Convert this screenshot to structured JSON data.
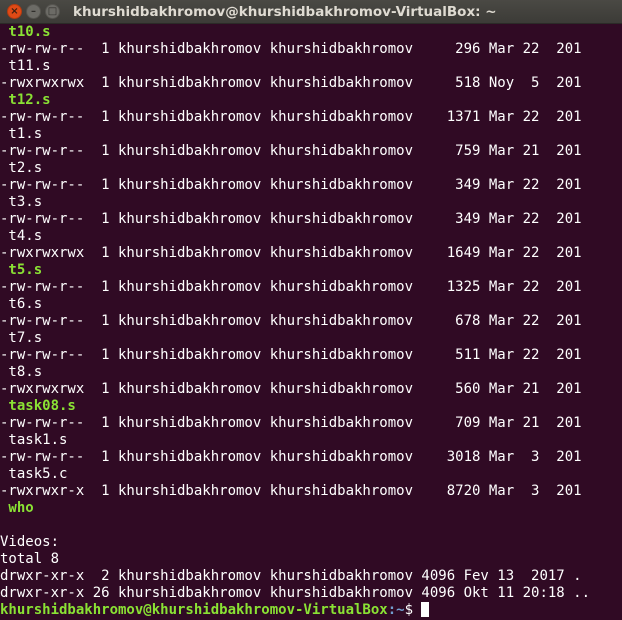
{
  "window": {
    "title": "khurshidbakhromov@khurshidbakhromov-VirtualBox: ~",
    "close_symbol": "×",
    "minimize_symbol": "–",
    "maximize_symbol": "□"
  },
  "terminal": {
    "lines": [
      {
        "text": " t10.s",
        "style": "green"
      },
      {
        "text": "-rw-rw-r--  1 khurshidbakhromov khurshidbakhromov     296 Mar 22  201",
        "style": "plain"
      },
      {
        "text": " t11.s",
        "style": "plain"
      },
      {
        "text": "-rwxrwxrwx  1 khurshidbakhromov khurshidbakhromov     518 Noy  5  201",
        "style": "plain"
      },
      {
        "text": " t12.s",
        "style": "green"
      },
      {
        "text": "-rw-rw-r--  1 khurshidbakhromov khurshidbakhromov    1371 Mar 22  201",
        "style": "plain"
      },
      {
        "text": " t1.s",
        "style": "plain"
      },
      {
        "text": "-rw-rw-r--  1 khurshidbakhromov khurshidbakhromov     759 Mar 21  201",
        "style": "plain"
      },
      {
        "text": " t2.s",
        "style": "plain"
      },
      {
        "text": "-rw-rw-r--  1 khurshidbakhromov khurshidbakhromov     349 Mar 22  201",
        "style": "plain"
      },
      {
        "text": " t3.s",
        "style": "plain"
      },
      {
        "text": "-rw-rw-r--  1 khurshidbakhromov khurshidbakhromov     349 Mar 22  201",
        "style": "plain"
      },
      {
        "text": " t4.s",
        "style": "plain"
      },
      {
        "text": "-rwxrwxrwx  1 khurshidbakhromov khurshidbakhromov    1649 Mar 22  201",
        "style": "plain"
      },
      {
        "text": " t5.s",
        "style": "green"
      },
      {
        "text": "-rw-rw-r--  1 khurshidbakhromov khurshidbakhromov    1325 Mar 22  201",
        "style": "plain"
      },
      {
        "text": " t6.s",
        "style": "plain"
      },
      {
        "text": "-rw-rw-r--  1 khurshidbakhromov khurshidbakhromov     678 Mar 22  201",
        "style": "plain"
      },
      {
        "text": " t7.s",
        "style": "plain"
      },
      {
        "text": "-rw-rw-r--  1 khurshidbakhromov khurshidbakhromov     511 Mar 22  201",
        "style": "plain"
      },
      {
        "text": " t8.s",
        "style": "plain"
      },
      {
        "text": "-rwxrwxrwx  1 khurshidbakhromov khurshidbakhromov     560 Mar 21  201",
        "style": "plain"
      },
      {
        "text": " task08.s",
        "style": "green"
      },
      {
        "text": "-rw-rw-r--  1 khurshidbakhromov khurshidbakhromov     709 Mar 21  201",
        "style": "plain"
      },
      {
        "text": " task1.s",
        "style": "plain"
      },
      {
        "text": "-rw-rw-r--  1 khurshidbakhromov khurshidbakhromov    3018 Mar  3  201",
        "style": "plain"
      },
      {
        "text": " task5.c",
        "style": "plain"
      },
      {
        "text": "-rwxrwxr-x  1 khurshidbakhromov khurshidbakhromov    8720 Mar  3  201",
        "style": "plain"
      },
      {
        "text": " who",
        "style": "green"
      },
      {
        "text": "",
        "style": "plain"
      },
      {
        "text": "Videos:",
        "style": "plain"
      },
      {
        "text": "total 8",
        "style": "plain"
      },
      {
        "text": "drwxr-xr-x  2 khurshidbakhromov khurshidbakhromov 4096 Fev 13  2017 .",
        "style": "plain"
      },
      {
        "text": "drwxr-xr-x 26 khurshidbakhromov khurshidbakhromov 4096 Okt 11 20:18 ..",
        "style": "plain"
      }
    ],
    "prompt": {
      "user_host": "khurshidbakhromov@khurshidbakhromov-VirtualBox",
      "path": ":~",
      "symbol": "$ "
    }
  },
  "colors": {
    "background": "#300a24",
    "text": "#ffffff",
    "executable": "#8ae234",
    "path": "#729fcf",
    "close_button": "#df4a16"
  }
}
